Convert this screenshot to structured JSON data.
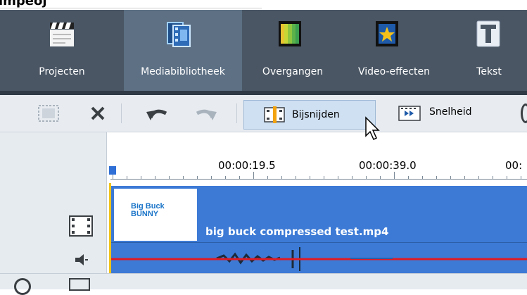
{
  "top_partial": "lmpeoj",
  "ribbon": {
    "items": [
      {
        "label": "Projecten",
        "icon": "clapperboard-icon"
      },
      {
        "label": "Mediabibliotheek",
        "icon": "media-library-icon",
        "active": true
      },
      {
        "label": "Overgangen",
        "icon": "transitions-icon"
      },
      {
        "label": "Video-effecten",
        "icon": "star-effect-icon"
      },
      {
        "label": "Tekst",
        "icon": "text-T-icon"
      }
    ]
  },
  "toolbar": {
    "trim_label": "Bijsnijden",
    "speed_label": "Snelheid"
  },
  "ruler": {
    "labels": [
      "00:00:19.5",
      "00:00:39.0",
      "00:"
    ]
  },
  "clip": {
    "name": "big buck compressed test.mp4",
    "thumbnail_text_line1": "Big Buck",
    "thumbnail_text_line2": "BUNNY"
  },
  "colors": {
    "ribbon_bg": "#4a5664",
    "ribbon_active": "#5d7084",
    "clip_blue": "#3c7ad6",
    "playhead_yellow": "#f0c419",
    "audio_line_red": "#e01b24"
  }
}
